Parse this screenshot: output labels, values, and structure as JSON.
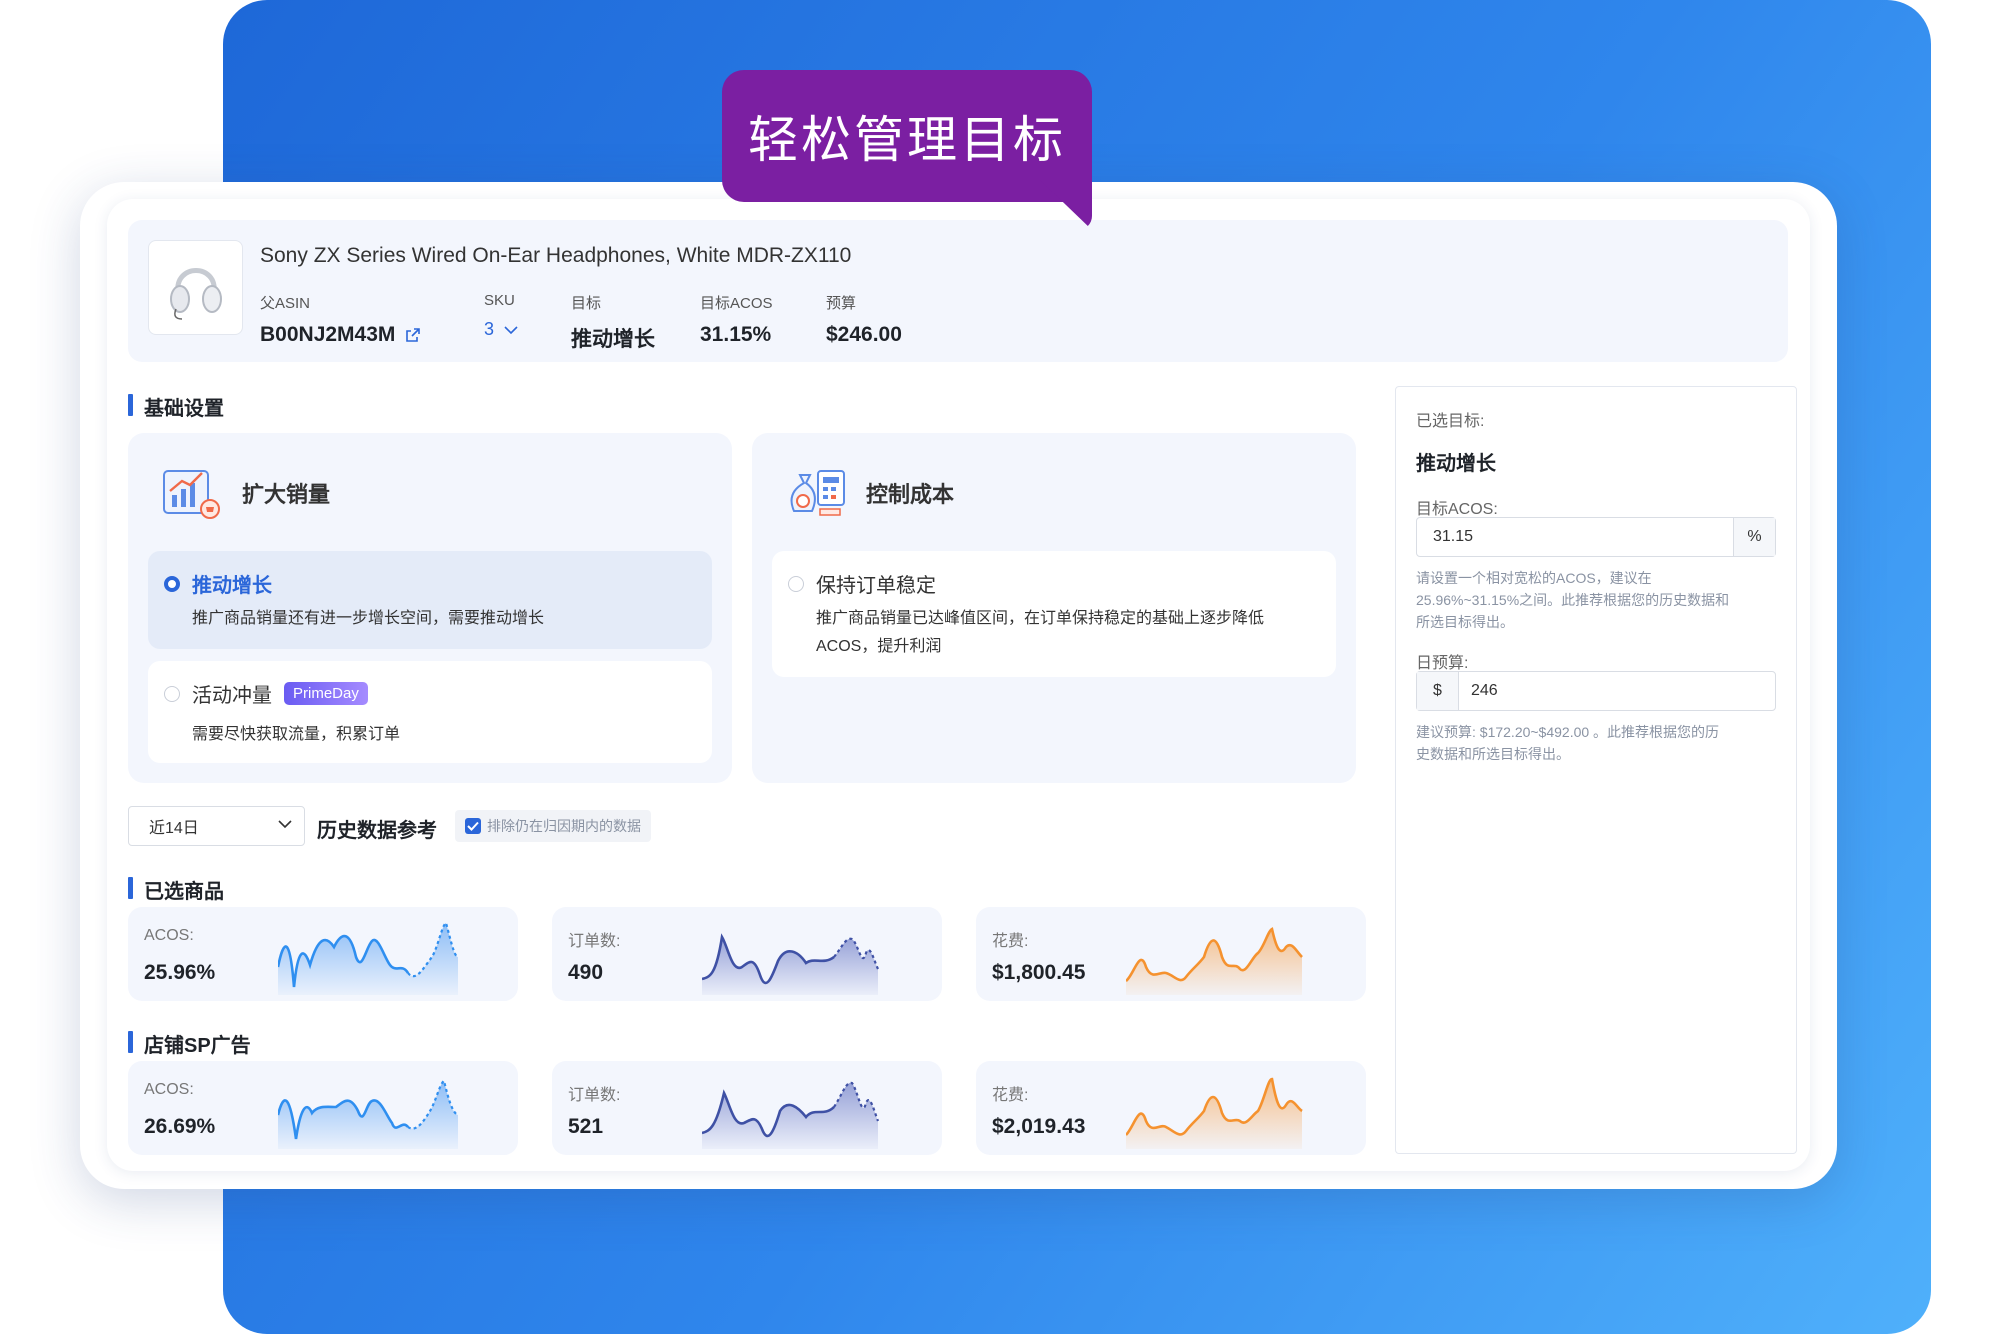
{
  "banner": {
    "title": "轻松管理目标"
  },
  "product": {
    "title": "Sony ZX Series Wired On-Ear Headphones, White MDR-ZX110",
    "thumb_icon": "headphones-icon",
    "parent_asin_label": "父ASIN",
    "parent_asin_value": "B00NJ2M43M",
    "sku_label": "SKU",
    "sku_value": "3",
    "goal_label": "目标",
    "goal_value": "推动增长",
    "acos_label": "目标ACOS",
    "acos_value": "31.15%",
    "budget_label": "预算",
    "budget_value": "$246.00"
  },
  "basic_settings": {
    "title": "基础设置",
    "groups": [
      {
        "title": "扩大销量",
        "icon": "sales-chart-icon",
        "options": [
          {
            "name": "推动增长",
            "desc": "推广商品销量还有进一步增长空间，需要推动增长",
            "selected": true
          },
          {
            "name": "活动冲量",
            "tag": "PrimeDay",
            "desc": "需要尽快获取流量，积累订单",
            "selected": false
          }
        ]
      },
      {
        "title": "控制成本",
        "icon": "cost-control-icon",
        "options": [
          {
            "name": "保持订单稳定",
            "desc_line1": "推广商品销量已达峰值区间，在订单保持稳定的基础上逐步降低",
            "desc_line2": "ACOS，提升利润",
            "selected": false
          }
        ]
      }
    ]
  },
  "history": {
    "range_value": "近14日",
    "title": "历史数据参考",
    "exclude_label": "排除仍在归因期内的数据",
    "exclude_checked": true
  },
  "selected_products": {
    "title": "已选商品",
    "metrics": [
      {
        "label": "ACOS:",
        "value": "25.96%"
      },
      {
        "label": "订单数:",
        "value": "490"
      },
      {
        "label": "花费:",
        "value": "$1,800.45"
      }
    ]
  },
  "store_sp": {
    "title": "店铺SP广告",
    "metrics": [
      {
        "label": "ACOS:",
        "value": "26.69%"
      },
      {
        "label": "订单数:",
        "value": "521"
      },
      {
        "label": "花费:",
        "value": "$2,019.43"
      }
    ]
  },
  "side": {
    "selected_label": "已选目标:",
    "selected_goal": "推动增长",
    "acos_label": "目标ACOS:",
    "acos_value": "31.15",
    "acos_unit": "%",
    "acos_hint_1": "请设置一个相对宽松的ACOS，建议在",
    "acos_hint_2": "25.96%~31.15%之间。此推荐根据您的历史数据和",
    "acos_hint_3": "所选目标得出。",
    "budget_label": "日预算:",
    "budget_prefix": "$",
    "budget_value": "246",
    "budget_hint_1": "建议预算: $172.20~$492.00 。此推荐根据您的历",
    "budget_hint_2": "史数据和所选目标得出。"
  },
  "colors": {
    "accent": "#2b66d9",
    "purple": "#7b1fa2",
    "orange": "#f5922f",
    "navy": "#3f51a5",
    "blue": "#2f8ff0"
  }
}
